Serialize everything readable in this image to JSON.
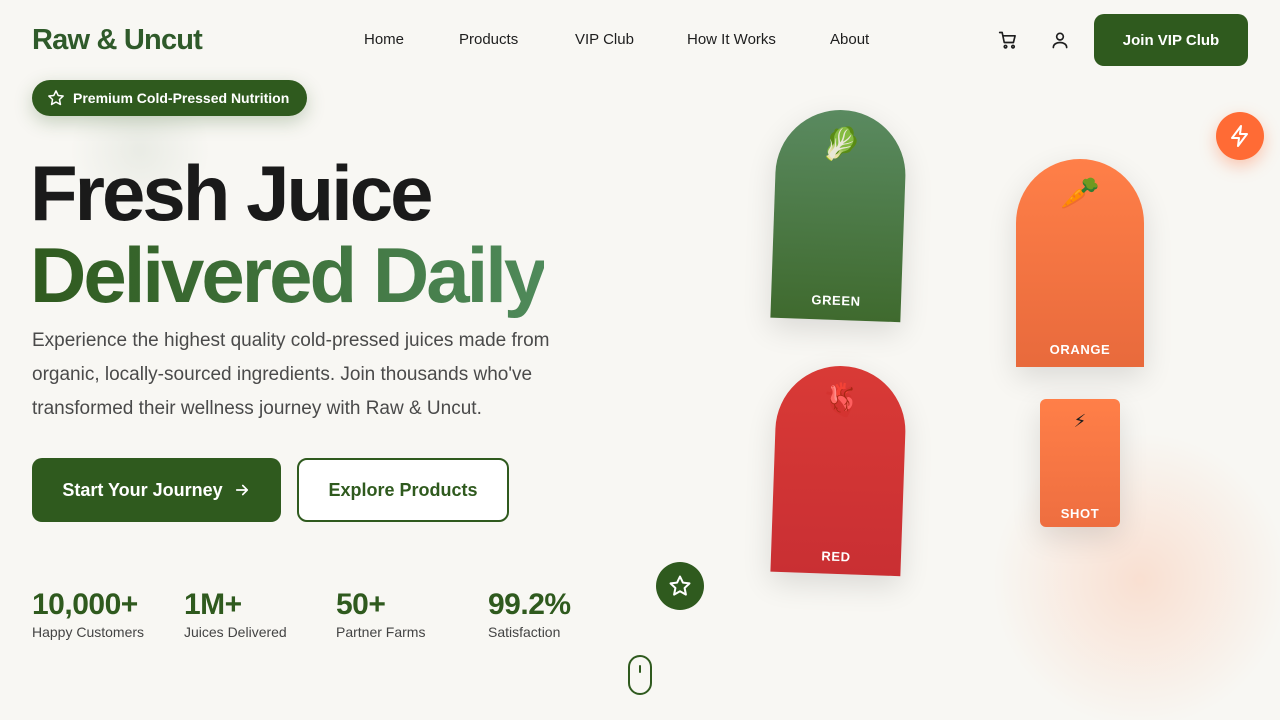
{
  "header": {
    "logo": "Raw & Uncut",
    "nav": [
      "Home",
      "Products",
      "VIP Club",
      "How It Works",
      "About"
    ],
    "join_label": "Join VIP Club",
    "icons": [
      "cart-icon",
      "user-icon"
    ]
  },
  "hero": {
    "badge": "Premium Cold-Pressed Nutrition",
    "title_line1": "Fresh Juice",
    "title_line2": "Delivered Daily",
    "description": "Experience the highest quality cold-pressed juices made from organic, locally-sourced ingredients. Join thousands who've transformed their wellness journey with Raw & Uncut.",
    "primary_cta": "Start Your Journey",
    "secondary_cta": "Explore Products"
  },
  "stats": [
    {
      "value": "10,000+",
      "label": "Happy Customers"
    },
    {
      "value": "1M+",
      "label": "Juices Delivered"
    },
    {
      "value": "50+",
      "label": "Partner Farms"
    },
    {
      "value": "99.2%",
      "label": "Satisfaction"
    }
  ],
  "bottles": [
    {
      "emoji": "🥬",
      "label": "GREEN"
    },
    {
      "emoji": "🥕",
      "label": "ORANGE"
    },
    {
      "emoji": "🫀",
      "label": "RED"
    },
    {
      "emoji": "⚡",
      "label": "SHOT"
    }
  ],
  "colors": {
    "brand_green": "#2f5a1e",
    "accent_orange": "#ff6b35",
    "background": "#f8f7f3"
  }
}
